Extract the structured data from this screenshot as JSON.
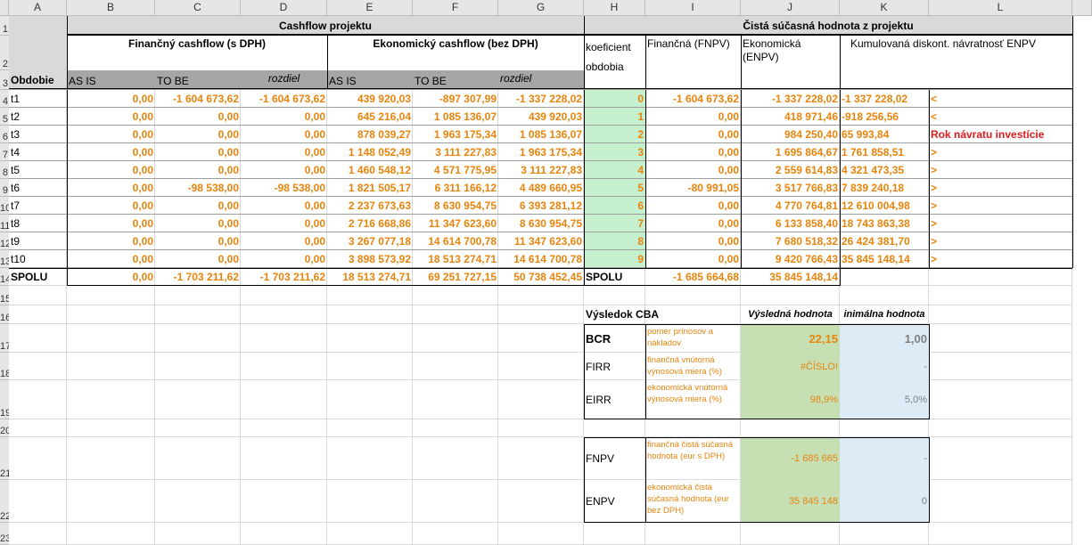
{
  "columns": [
    "A",
    "B",
    "C",
    "D",
    "E",
    "F",
    "G",
    "H",
    "I",
    "J",
    "K",
    "L"
  ],
  "row_numbers": [
    "1",
    "2",
    "3",
    "4",
    "5",
    "6",
    "7",
    "8",
    "9",
    "10",
    "11",
    "12",
    "13",
    "14",
    "15",
    "16",
    "17",
    "18",
    "19",
    "20",
    "21",
    "22",
    "23"
  ],
  "header": {
    "cashflow_title": "Cashflow projektu",
    "npv_title": "Čistá súčasná hodnota z projektu",
    "fin_cf": "Finančný cashflow (s DPH)",
    "eco_cf": "Ekonomický cashflow (bez DPH)",
    "koef": "koeficient obdobia",
    "fnpv": "Finančná (FNPV)",
    "enpv": "Ekonomická (ENPV)",
    "cum": "Kumulovaná diskont. návratnosť ENPV",
    "obdobie": "Obdobie",
    "asis": "AS IS",
    "tobe": "TO BE",
    "rozdiel": "rozdiel",
    "asis2": "AS IS",
    "tobe2": "TO BE",
    "rozdiel2": "rozdiel"
  },
  "rows": [
    {
      "p": "t1",
      "b": "0,00",
      "c": "-1 604 673,62",
      "d": "-1 604 673,62",
      "e": "439 920,03",
      "f": "-897 307,99",
      "g": "-1 337 228,02",
      "h": "0",
      "i": "-1 604 673,62",
      "j": "-1 337 228,02",
      "k": "-1 337 228,02",
      "l": "<"
    },
    {
      "p": "t2",
      "b": "0,00",
      "c": "0,00",
      "d": "0,00",
      "e": "645 216,04",
      "f": "1 085 136,07",
      "g": "439 920,03",
      "h": "1",
      "i": "0,00",
      "j": "418 971,46",
      "k": "-918 256,56",
      "l": "<"
    },
    {
      "p": "t3",
      "b": "0,00",
      "c": "0,00",
      "d": "0,00",
      "e": "878 039,27",
      "f": "1 963 175,34",
      "g": "1 085 136,07",
      "h": "2",
      "i": "0,00",
      "j": "984 250,40",
      "k": "65 993,84",
      "l": "Rok návratu investície"
    },
    {
      "p": "t4",
      "b": "0,00",
      "c": "0,00",
      "d": "0,00",
      "e": "1 148 052,49",
      "f": "3 111 227,83",
      "g": "1 963 175,34",
      "h": "3",
      "i": "0,00",
      "j": "1 695 864,67",
      "k": "1 761 858,51",
      "l": ">"
    },
    {
      "p": "t5",
      "b": "0,00",
      "c": "0,00",
      "d": "0,00",
      "e": "1 460 548,12",
      "f": "4 571 775,95",
      "g": "3 111 227,83",
      "h": "4",
      "i": "0,00",
      "j": "2 559 614,83",
      "k": "4 321 473,35",
      "l": ">"
    },
    {
      "p": "t6",
      "b": "0,00",
      "c": "-98 538,00",
      "d": "-98 538,00",
      "e": "1 821 505,17",
      "f": "6 311 166,12",
      "g": "4 489 660,95",
      "h": "5",
      "i": "-80 991,05",
      "j": "3 517 766,83",
      "k": "7 839 240,18",
      "l": ">"
    },
    {
      "p": "t7",
      "b": "0,00",
      "c": "0,00",
      "d": "0,00",
      "e": "2 237 673,63",
      "f": "8 630 954,75",
      "g": "6 393 281,12",
      "h": "6",
      "i": "0,00",
      "j": "4 770 764,81",
      "k": "12 610 004,98",
      "l": ">"
    },
    {
      "p": "t8",
      "b": "0,00",
      "c": "0,00",
      "d": "0,00",
      "e": "2 716 668,86",
      "f": "11 347 623,60",
      "g": "8 630 954,75",
      "h": "7",
      "i": "0,00",
      "j": "6 133 858,40",
      "k": "18 743 863,38",
      "l": ">"
    },
    {
      "p": "t9",
      "b": "0,00",
      "c": "0,00",
      "d": "0,00",
      "e": "3 267 077,18",
      "f": "14 614 700,78",
      "g": "11 347 623,60",
      "h": "8",
      "i": "0,00",
      "j": "7 680 518,32",
      "k": "26 424 381,70",
      "l": ">"
    },
    {
      "p": "t10",
      "b": "0,00",
      "c": "0,00",
      "d": "0,00",
      "e": "3 898 573,92",
      "f": "18 513 274,71",
      "g": "14 614 700,78",
      "h": "9",
      "i": "0,00",
      "j": "9 420 766,43",
      "k": "35 845 148,14",
      "l": ">"
    }
  ],
  "spolu": {
    "label": "SPOLU",
    "b": "0,00",
    "c": "-1 703 211,62",
    "d": "-1 703 211,62",
    "e": "18 513 274,71",
    "f": "69 251 727,15",
    "g": "50 738 452,45",
    "h": "SPOLU",
    "i": "-1 685 664,68",
    "j": "35 845 148,14"
  },
  "cba": {
    "title": "Výsledok CBA",
    "result_hdr": "Výsledná hodnota",
    "min_hdr": "inimálna hodnota",
    "rows": [
      {
        "name": "BCR",
        "desc": "pomer prínosov a nákladov",
        "val": "22,15",
        "min": "1,00"
      },
      {
        "name": "FIRR",
        "desc": "finančná vnútorná výnosová miera (%)",
        "val": "#ČÍSLO!",
        "min": "-"
      },
      {
        "name": "EIRR",
        "desc": "ekonomická vnútorná výnosová miera (%)",
        "val": "98,9%",
        "min": "5,0%"
      },
      {
        "name": "FNPV",
        "desc": "finančná čistá súčasná hodnota (eur s DPH)",
        "val": "-1 685 665",
        "min": "-"
      },
      {
        "name": "ENPV",
        "desc": "ekonomická čistá súčasná hodnota (eur bez DPH)",
        "val": "35 845 148",
        "min": "0"
      }
    ]
  },
  "colors": {
    "orange": "#e8840c",
    "green": "#c6e0b4",
    "lightgreen": "#c6efce",
    "blue": "#ddebf7",
    "grayhdr": "#a6a6a6",
    "red": "#e01c1c"
  }
}
